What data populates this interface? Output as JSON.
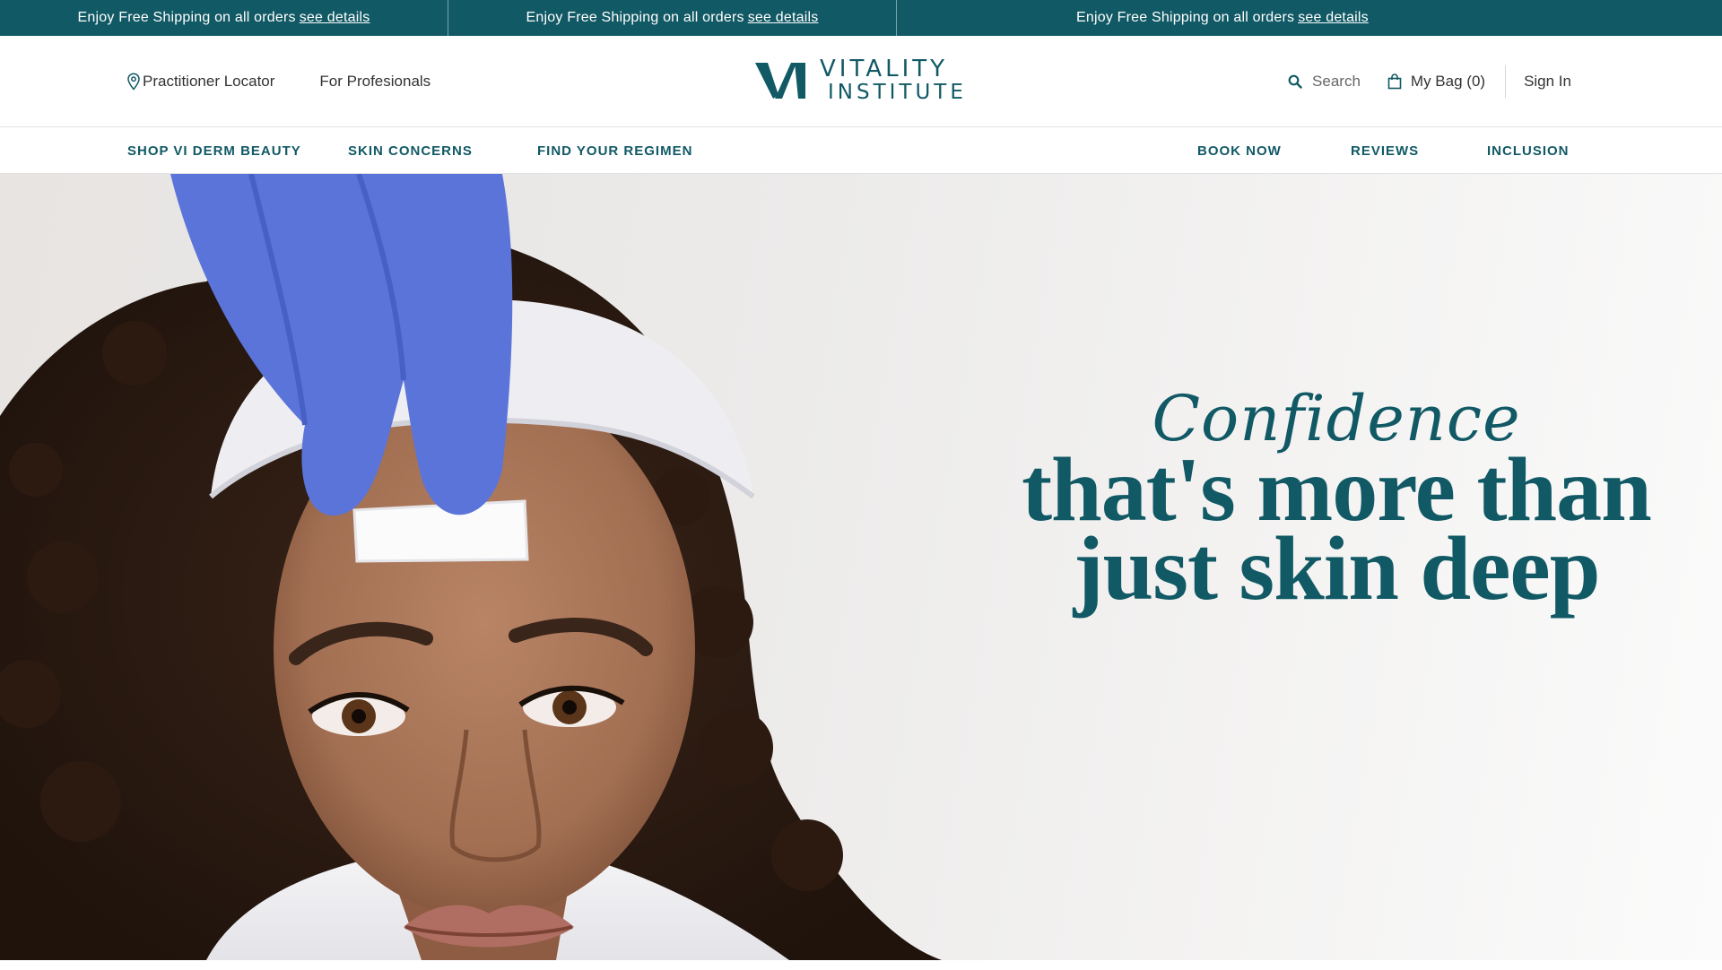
{
  "promo": [
    {
      "text": "Enjoy Free Shipping on all orders",
      "link": " see details"
    },
    {
      "text": "Enjoy Free Shipping on all orders",
      "link": " see details"
    },
    {
      "text": "Enjoy Free Shipping on all orders",
      "link": " see details"
    }
  ],
  "header": {
    "practitioner_locator": "Practitioner Locator",
    "for_professionals": "For Profesionals",
    "logo_line1": "VITALITY",
    "logo_line2": "INSTITUTE",
    "search_label": "Search",
    "bag_label": "My Bag (0)",
    "sign_in": "Sign In"
  },
  "nav": {
    "left": [
      "SHOP VI DERM BEAUTY",
      "SKIN CONCERNS",
      "FIND YOUR REGIMEN"
    ],
    "right": [
      "BOOK NOW",
      "REVIEWS",
      "INCLUSION"
    ]
  },
  "hero": {
    "script": "Confidence",
    "headline_line1": "that's more than",
    "headline_line2": "just skin deep"
  },
  "colors": {
    "brand": "#115965",
    "text": "#333333",
    "glove": "#5b74d9"
  },
  "icons": [
    "map-pin-icon",
    "search-icon",
    "bag-icon",
    "brand-logo-mark"
  ]
}
